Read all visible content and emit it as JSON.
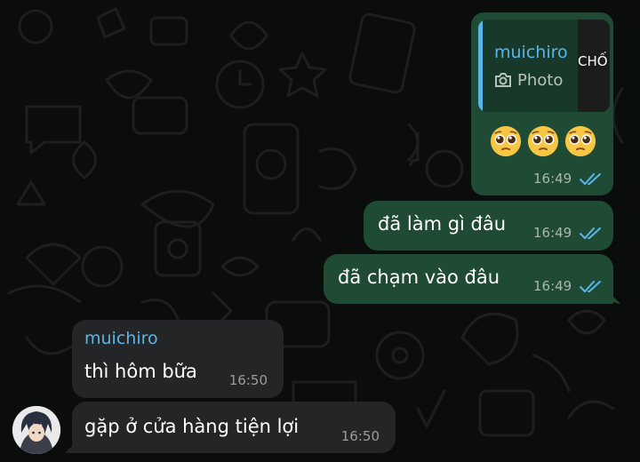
{
  "chat": {
    "messages": [
      {
        "direction": "outgoing",
        "reply": {
          "name": "muichiro",
          "media_label": "Photo",
          "thumb_text": "CHỐ"
        },
        "emojis": [
          "pleading-face",
          "pleading-face",
          "pleading-face"
        ],
        "time": "16:49",
        "status": "read"
      },
      {
        "direction": "outgoing",
        "text": "đã làm gì đâu",
        "time": "16:49",
        "status": "read"
      },
      {
        "direction": "outgoing",
        "text": "đã chạm vào đâu",
        "time": "16:49",
        "status": "read"
      },
      {
        "direction": "incoming",
        "sender": "muichiro",
        "text": "thì hôm bữa",
        "time": "16:50"
      },
      {
        "direction": "incoming",
        "text": "gặp ở cửa hàng tiện lợi",
        "time": "16:50"
      }
    ]
  },
  "colors": {
    "background": "#0b0c0c",
    "outgoing_bubble": "#1f4a33",
    "incoming_bubble": "#232526",
    "accent_blue": "#58b6e8",
    "read_ticks": "#58b6e8"
  },
  "icons": [
    "camera-icon",
    "double-check-icon",
    "pleading-face-emoji",
    "avatar"
  ]
}
